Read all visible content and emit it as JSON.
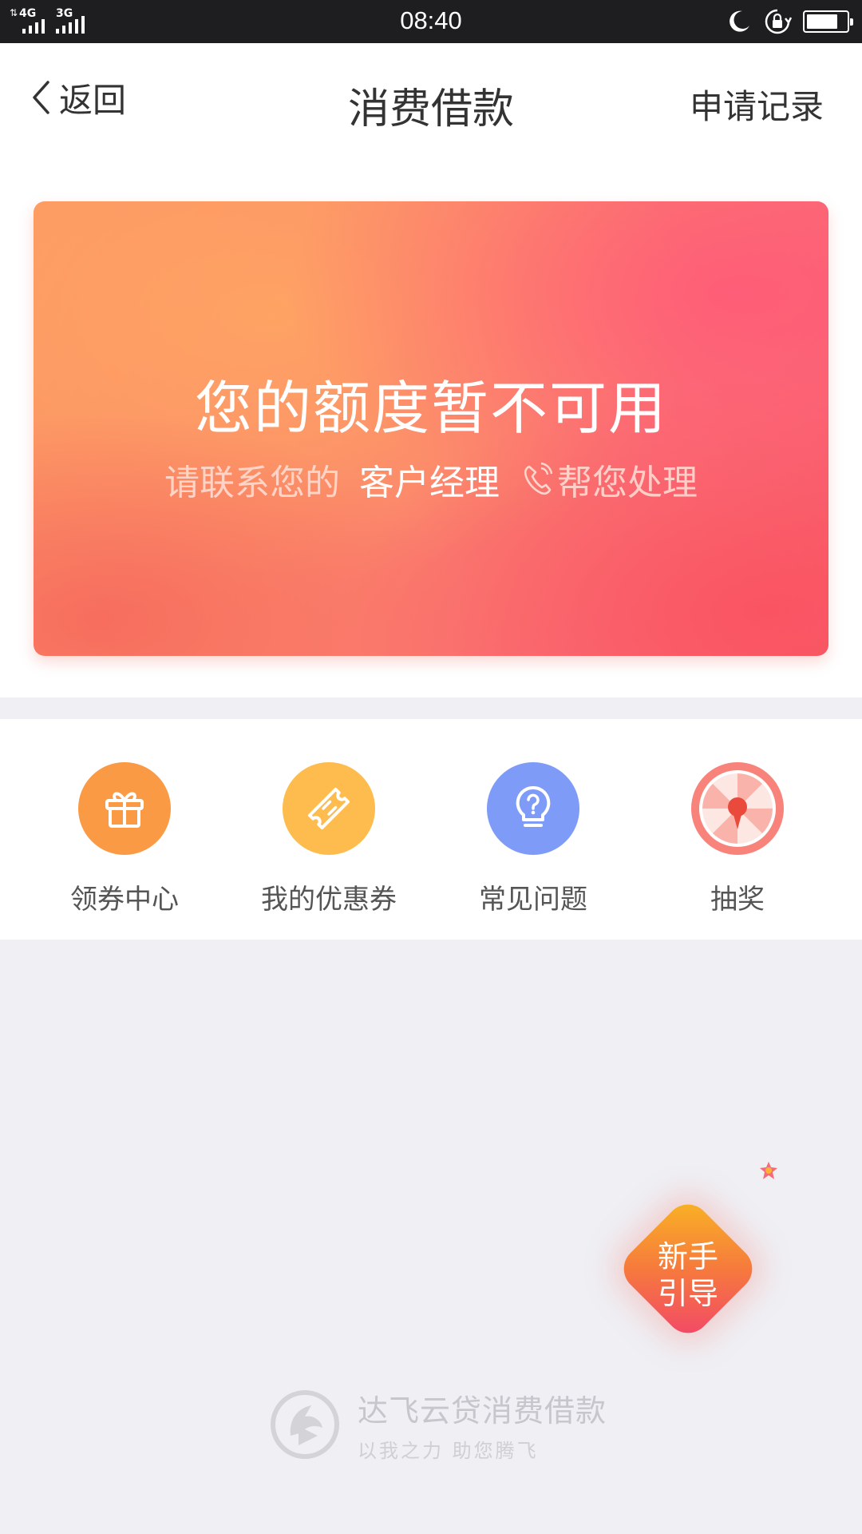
{
  "status_bar": {
    "time": "08:40",
    "network_1": "4G",
    "network_2": "3G",
    "battery_level": 0.8,
    "icons": [
      "moon-icon",
      "rotation-lock-icon",
      "battery-icon"
    ]
  },
  "nav": {
    "back_label": "返回",
    "title": "消费借款",
    "record_label": "申请记录"
  },
  "card": {
    "title": "您的额度暂不可用",
    "sub_prefix": "请联系您的",
    "sub_highlight": "客户经理",
    "sub_suffix": "帮您处理"
  },
  "features": [
    {
      "label": "领券中心",
      "icon": "gift-icon",
      "color": "#fb9a45"
    },
    {
      "label": "我的优惠券",
      "icon": "ticket-icon",
      "color": "#fdbc4d"
    },
    {
      "label": "常见问题",
      "icon": "question-bulb-icon",
      "color": "#7e9cf7"
    },
    {
      "label": "抽奖",
      "icon": "lottery-wheel-icon",
      "color": "#f7837b"
    }
  ],
  "guide": {
    "line1": "新手",
    "line2": "引导"
  },
  "brand": {
    "name": "达飞云贷消费借款",
    "slogan": "以我之力  助您腾飞"
  }
}
